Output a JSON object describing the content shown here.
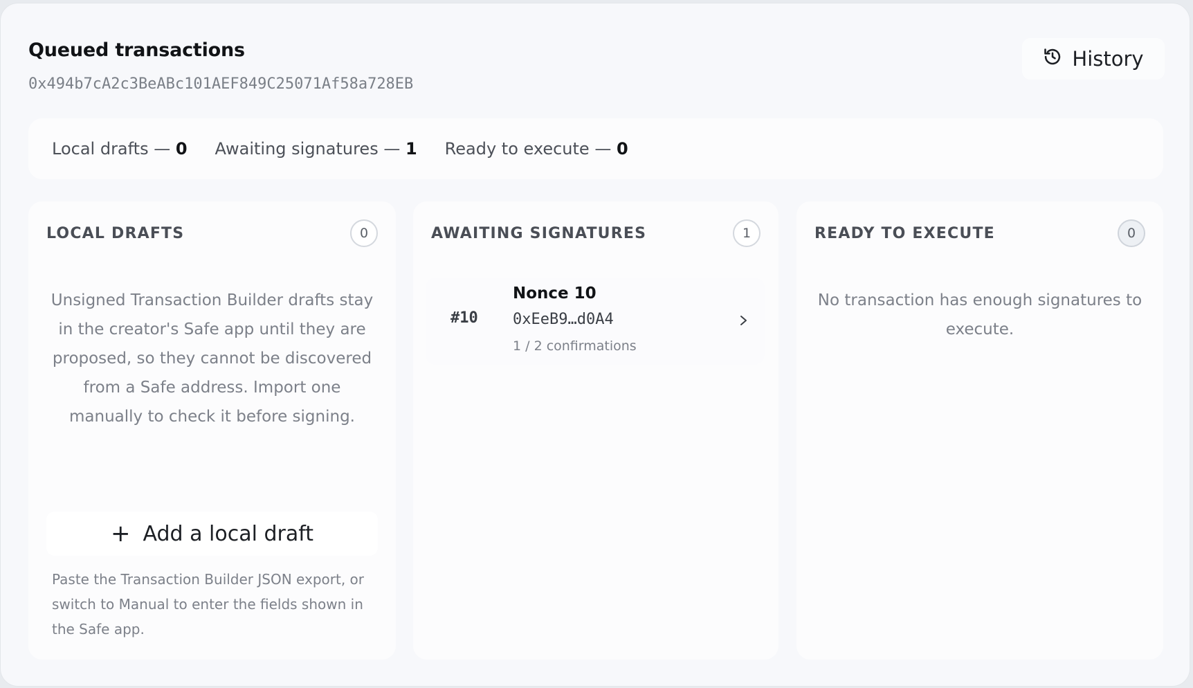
{
  "header": {
    "title": "Queued transactions",
    "address": "0x494b7cA2c3BeABc101AEF849C25071Af58a728EB",
    "history_label": "History"
  },
  "summary": {
    "local_drafts_label": "Local drafts — ",
    "local_drafts_count": "0",
    "awaiting_label": "Awaiting signatures — ",
    "awaiting_count": "1",
    "ready_label": "Ready to execute — ",
    "ready_count": "0"
  },
  "columns": {
    "local_drafts": {
      "title": "LOCAL DRAFTS",
      "count": "0",
      "empty_message": "Unsigned Transaction Builder drafts stay in the creator's Safe app until they are proposed, so they cannot be discovered from a Safe address. Import one manually to check it before signing.",
      "add_button_label": "Add a local draft",
      "hint": "Paste the Transaction Builder JSON export, or switch to Manual to enter the fields shown in the Safe app."
    },
    "awaiting": {
      "title": "AWAITING SIGNATURES",
      "count": "1",
      "transactions": [
        {
          "number": "#10",
          "nonce_label": "Nonce 10",
          "address": "0xEeB9…d0A4",
          "confirmations": "1 / 2 confirmations"
        }
      ]
    },
    "ready": {
      "title": "READY TO EXECUTE",
      "count": "0",
      "empty_message": "No transaction has enough signatures to execute."
    }
  },
  "icons": {
    "history": "history-icon",
    "plus": "plus-icon",
    "chevron": "chevron-right-icon"
  }
}
